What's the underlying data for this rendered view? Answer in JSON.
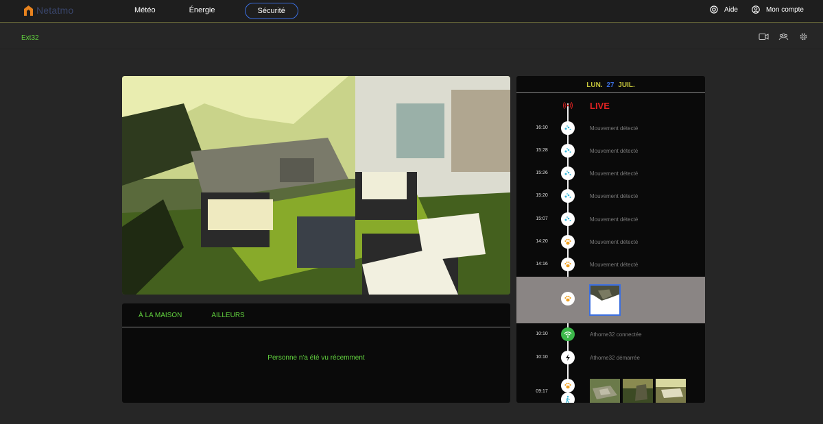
{
  "app": {
    "brand": "Netatmo",
    "brand_color": "#e8831e"
  },
  "nav": {
    "items": [
      "Météo",
      "Énergie",
      "Sécurité"
    ],
    "active": "Sécurité"
  },
  "account": {
    "help": "Aide",
    "account": "Mon compte"
  },
  "home": {
    "name": "Ext32"
  },
  "presence": {
    "tabs": [
      "À LA MAISON",
      "AILLEURS"
    ],
    "empty_message": "Personne n'a été vu récemment"
  },
  "timeline": {
    "date": {
      "weekday": "LUN.",
      "day": "27",
      "month": "JUIL."
    },
    "live_label": "LIVE",
    "events": [
      {
        "time": "16:10",
        "icon": "motion-icon",
        "text": "Mouvement détecté"
      },
      {
        "time": "15:28",
        "icon": "motion-icon",
        "text": "Mouvement détecté"
      },
      {
        "time": "15:26",
        "icon": "motion-icon",
        "text": "Mouvement détecté"
      },
      {
        "time": "15:20",
        "icon": "motion-icon",
        "text": "Mouvement détecté"
      },
      {
        "time": "15:07",
        "icon": "motion-icon",
        "text": "Mouvement détecté"
      },
      {
        "time": "14:20",
        "icon": "paw-icon",
        "text": "Mouvement détecté"
      },
      {
        "time": "14:16",
        "icon": "paw-icon",
        "text": "Mouvement détecté"
      },
      {
        "time": "10:10",
        "icon": "wifi-icon",
        "text": "Athome32 connectée"
      },
      {
        "time": "10:10",
        "icon": "power-icon",
        "text": "Athome32 démarrée"
      },
      {
        "time": "09:17",
        "icon": "paw-icon",
        "text": ""
      }
    ],
    "selected_event": {
      "time": "",
      "icon": "paw-icon"
    }
  },
  "colors": {
    "accent_green": "#63d43f",
    "accent_blue": "#3b6fe0",
    "live_red": "#e02222"
  }
}
